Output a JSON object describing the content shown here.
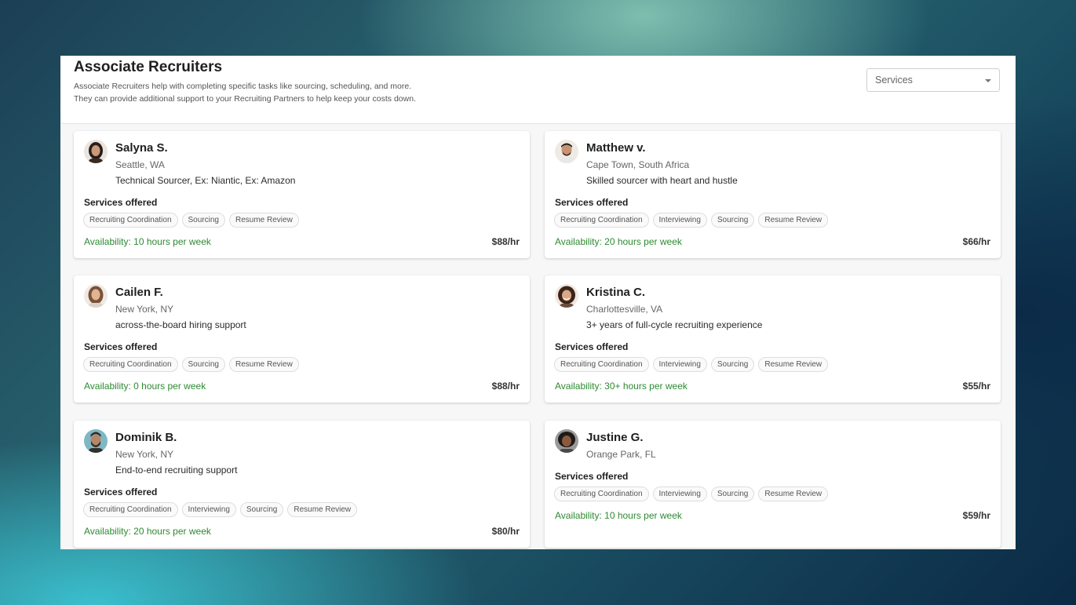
{
  "header": {
    "title": "Associate Recruiters",
    "description_line1": "Associate Recruiters help with completing specific tasks like sourcing, scheduling, and more.",
    "description_line2": "They can provide additional support to your Recruiting Partners to help keep your costs down.",
    "filter_label": "Services"
  },
  "services_label": "Services offered",
  "recruiters": [
    {
      "name": "Salyna S.",
      "location": "Seattle, WA",
      "tagline": "Technical Sourcer, Ex: Niantic, Ex: Amazon",
      "services": [
        "Recruiting Coordination",
        "Sourcing",
        "Resume Review"
      ],
      "availability": "Availability: 10 hours per week",
      "rate": "$88/hr",
      "avatar_color": "#3a2a22"
    },
    {
      "name": "Matthew v.",
      "location": "Cape Town, South Africa",
      "tagline": "Skilled sourcer with heart and hustle",
      "services": [
        "Recruiting Coordination",
        "Interviewing",
        "Sourcing",
        "Resume Review"
      ],
      "availability": "Availability: 20 hours per week",
      "rate": "$66/hr",
      "avatar_color": "#2a1f1a"
    },
    {
      "name": "Cailen F.",
      "location": "New York, NY",
      "tagline": "across-the-board hiring support",
      "services": [
        "Recruiting Coordination",
        "Sourcing",
        "Resume Review"
      ],
      "availability": "Availability: 0 hours per week",
      "rate": "$88/hr",
      "avatar_color": "#6b4a30"
    },
    {
      "name": "Kristina C.",
      "location": "Charlottesville, VA",
      "tagline": "3+ years of full-cycle recruiting experience",
      "services": [
        "Recruiting Coordination",
        "Interviewing",
        "Sourcing",
        "Resume Review"
      ],
      "availability": "Availability: 30+ hours per week",
      "rate": "$55/hr",
      "avatar_color": "#3b2418"
    },
    {
      "name": "Dominik B.",
      "location": "New York, NY",
      "tagline": "End-to-end recruiting support",
      "services": [
        "Recruiting Coordination",
        "Interviewing",
        "Sourcing",
        "Resume Review"
      ],
      "availability": "Availability: 20 hours per week",
      "rate": "$80/hr",
      "avatar_color": "#2b2b2b"
    },
    {
      "name": "Justine G.",
      "location": "Orange Park, FL",
      "tagline": "",
      "services": [
        "Recruiting Coordination",
        "Interviewing",
        "Sourcing",
        "Resume Review"
      ],
      "availability": "Availability: 10 hours per week",
      "rate": "$59/hr",
      "avatar_color": "#1e1a18"
    }
  ]
}
